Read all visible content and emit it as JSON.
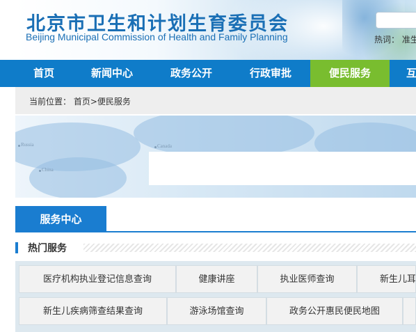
{
  "header": {
    "title_cn": "北京市卫生和计划生育委员会",
    "title_en": "Beijing Municipal Commission of Health and Family Planning",
    "search_placeholder": "",
    "hot_label": "热词： 准生"
  },
  "nav": {
    "items": [
      {
        "label": "首页"
      },
      {
        "label": "新闻中心"
      },
      {
        "label": "政务公开"
      },
      {
        "label": "行政审批"
      },
      {
        "label": "便民服务",
        "active": true
      },
      {
        "label": "互"
      }
    ],
    "color": "#0f7cc9",
    "active_color": "#79bd2f"
  },
  "breadcrumb": {
    "text": "当前位置： 首页>便民服务"
  },
  "banner": {
    "labels": [
      "Russia",
      "China",
      "Canada"
    ]
  },
  "tab": {
    "label": "服务中心"
  },
  "section": {
    "title": "热门服务"
  },
  "services": {
    "row1": [
      "医疗机构执业登记信息查询",
      "健康讲座",
      "执业医师查询",
      "新生儿耳"
    ],
    "row2": [
      "新生儿疾病筛查结果查询",
      "游泳场馆查询",
      "政务公开惠民便民地图",
      ""
    ]
  }
}
